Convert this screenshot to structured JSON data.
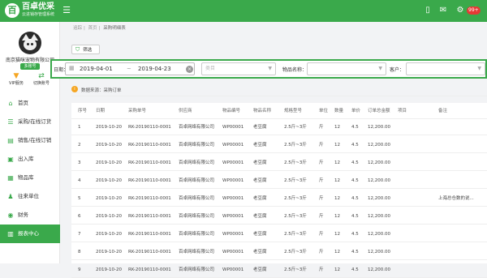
{
  "topbar": {
    "logo_mark": "百",
    "logo_name": "百卓优采",
    "logo_sub": "云进销存管理系统",
    "menu_icon": "menu-toggle-icon",
    "icons": [
      {
        "name": "phone-icon",
        "glyph": "▯"
      },
      {
        "name": "message-icon",
        "glyph": "✉"
      },
      {
        "name": "settings-icon",
        "glyph": "⚙"
      },
      {
        "name": "bell-icon",
        "glyph": "♪"
      }
    ],
    "badge": "99+",
    "accent": "#3aa94b"
  },
  "sidebar": {
    "company": "南京猫咪宠物有限公司",
    "login_label": "多账号",
    "vip_label": "VIP服务",
    "switch_label": "切换账号",
    "menu": [
      {
        "label": "首页",
        "icon": "home-icon",
        "glyph": "⌂"
      },
      {
        "label": "采购/在线订货",
        "icon": "purchase-icon",
        "glyph": "☰"
      },
      {
        "label": "销售/在线订销",
        "icon": "sales-icon",
        "glyph": "▤"
      },
      {
        "label": "出入库",
        "icon": "warehouse-icon",
        "glyph": "▣"
      },
      {
        "label": "物品库",
        "icon": "goods-icon",
        "glyph": "▦"
      },
      {
        "label": "往来单位",
        "icon": "partners-icon",
        "glyph": "♟"
      },
      {
        "label": "财务",
        "icon": "finance-icon",
        "glyph": "◉"
      },
      {
        "label": "报表中心",
        "icon": "report-icon",
        "glyph": "▥",
        "active": true
      }
    ]
  },
  "breadcrumb": [
    "追踪",
    "首页",
    "采购明细表"
  ],
  "filter_button": "筛选",
  "toolbar": {
    "date_label": "日期：",
    "date_start": "2019-04-01",
    "date_sep": "~",
    "date_end": "2019-04-23",
    "category_placeholder": "类目",
    "goods_label": "物品名称：",
    "customer_label": "客户："
  },
  "tab": {
    "label": "数据来源：采购订单"
  },
  "table": {
    "columns": [
      "序号",
      "日期",
      "采购单号",
      "供应商",
      "物品编号",
      "物品名称",
      "规格型号",
      "单位",
      "数量",
      "单价",
      "订单总金额",
      "项目",
      "备注"
    ],
    "rows": [
      [
        "1",
        "2019-10-20",
        "RK-20190110-0001",
        "百卓网络有限公司",
        "WP00001",
        "老豆腐",
        "2.5斤~3斤",
        "斤",
        "12",
        "4.5",
        "12,200.00",
        "",
        ""
      ],
      [
        "2",
        "2019-10-20",
        "RK-20190110-0001",
        "百卓网络有限公司",
        "WP00001",
        "老豆腐",
        "2.5斤~3斤",
        "斤",
        "12",
        "4.5",
        "12,200.00",
        "",
        ""
      ],
      [
        "3",
        "2019-10-20",
        "RK-20190110-0001",
        "百卓网络有限公司",
        "WP00001",
        "老豆腐",
        "2.5斤~3斤",
        "斤",
        "12",
        "4.5",
        "12,200.00",
        "",
        ""
      ],
      [
        "4",
        "2019-10-20",
        "RK-20190110-0001",
        "百卓网络有限公司",
        "WP00001",
        "老豆腐",
        "2.5斤~3斤",
        "斤",
        "12",
        "4.5",
        "12,200.00",
        "",
        ""
      ],
      [
        "5",
        "2019-10-20",
        "RK-20190110-0001",
        "百卓网络有限公司",
        "WP00001",
        "老豆腐",
        "2.5斤~3斤",
        "斤",
        "12",
        "4.5",
        "12,200.00",
        "",
        "上海总仓数的说..."
      ],
      [
        "6",
        "2019-10-20",
        "RK-20190110-0001",
        "百卓网络有限公司",
        "WP00001",
        "老豆腐",
        "2.5斤~3斤",
        "斤",
        "12",
        "4.5",
        "12,200.00",
        "",
        ""
      ],
      [
        "7",
        "2019-10-20",
        "RK-20190110-0001",
        "百卓网络有限公司",
        "WP00001",
        "老豆腐",
        "2.5斤~3斤",
        "斤",
        "12",
        "4.5",
        "12,200.00",
        "",
        ""
      ],
      [
        "8",
        "2019-10-20",
        "RK-20190110-0001",
        "百卓网络有限公司",
        "WP00001",
        "老豆腐",
        "2.5斤~3斤",
        "斤",
        "12",
        "4.5",
        "12,200.00",
        "",
        ""
      ],
      [
        "9",
        "2019-10-20",
        "RK-20190110-0001",
        "百卓网络有限公司",
        "WP00001",
        "老豆腐",
        "2.5斤~3斤",
        "斤",
        "12",
        "4.5",
        "12,200.00",
        "",
        ""
      ]
    ]
  }
}
